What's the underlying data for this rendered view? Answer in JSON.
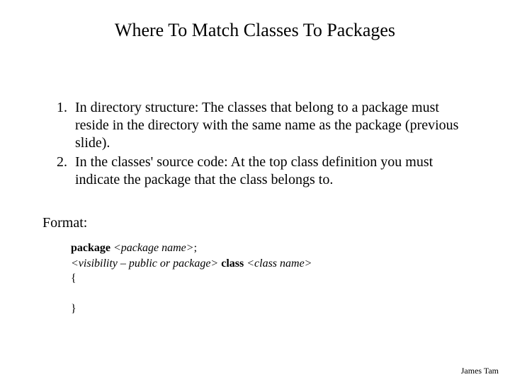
{
  "title": "Where To Match Classes To Packages",
  "list": {
    "item1": "In directory structure: The classes that belong to a package must reside in the directory with the same name as the package (previous slide).",
    "item2": "In the classes' source code:  At the top class definition you must indicate the package that the class belongs to."
  },
  "format_label": "Format:",
  "code": {
    "kw_package": "package ",
    "ph_pkgname": "<package name>",
    "semicolon": ";",
    "ph_visibility": "<visibility – public or package>",
    "kw_class": " class ",
    "ph_classname": "<class name>",
    "open_brace": "{",
    "close_brace": "}"
  },
  "footer": "James Tam"
}
